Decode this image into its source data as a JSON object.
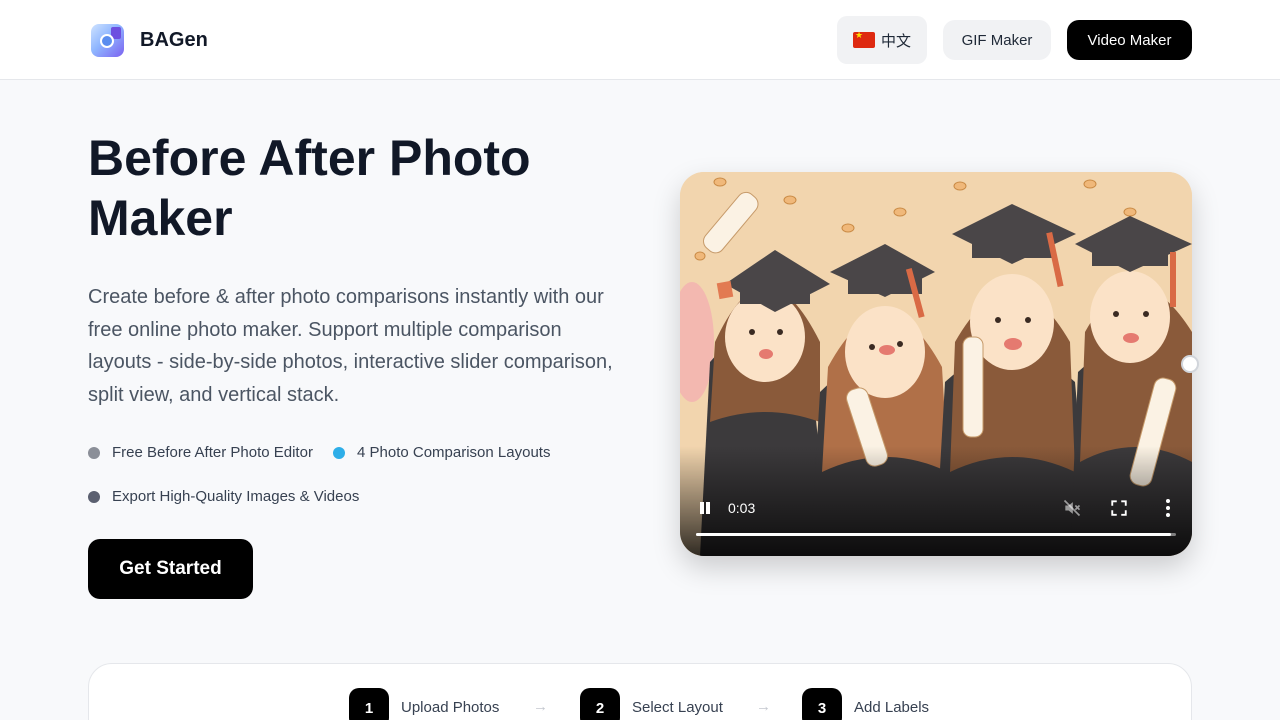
{
  "header": {
    "brand": "BAGen",
    "logo_icon": "aperture-logo-icon",
    "lang_flag_icon": "china-flag-icon",
    "lang_label": "中文",
    "gif_label": "GIF Maker",
    "video_label": "Video Maker"
  },
  "hero": {
    "title": "Before After Photo Maker",
    "description": "Create before & after photo comparisons instantly with our free online photo maker. Support multiple comparison layouts - side-by-side photos, interactive slider comparison, split view, and vertical stack.",
    "features": [
      {
        "label": "Free Before After Photo Editor",
        "dot_color": "#8b8f98"
      },
      {
        "label": "4 Photo Comparison Layouts",
        "dot_color": "#2eaee8"
      },
      {
        "label": "Export High-Quality Images & Videos",
        "dot_color": "#5b6070"
      }
    ],
    "cta": "Get Started"
  },
  "video": {
    "time": "0:03",
    "progress": 0.99,
    "muted": true,
    "playing": true,
    "icons": [
      "pause-icon",
      "mute-icon",
      "fullscreen-icon",
      "more-vert-icon"
    ]
  },
  "steps": [
    {
      "num": "1",
      "label": "Upload Photos"
    },
    {
      "num": "2",
      "label": "Select Layout"
    },
    {
      "num": "3",
      "label": "Add Labels"
    }
  ],
  "step_arrow": "→"
}
